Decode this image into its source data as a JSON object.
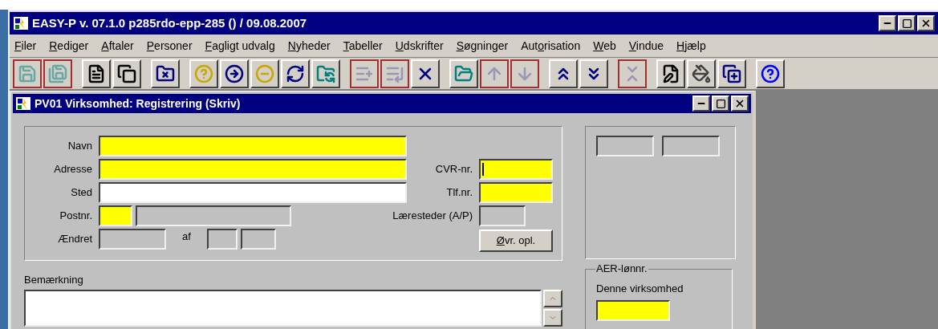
{
  "window": {
    "title": "EASY-P v. 07.1.0 p285rdo-epp-285 () / 09.08.2007"
  },
  "menu": [
    {
      "key": "F",
      "post": "iler"
    },
    {
      "key": "R",
      "post": "ediger"
    },
    {
      "key": "A",
      "post": "ftaler"
    },
    {
      "key": "P",
      "post": "ersoner"
    },
    {
      "key": "F",
      "post": "agligt udvalg"
    },
    {
      "key": "N",
      "post": "yheder"
    },
    {
      "key": "T",
      "post": "abeller"
    },
    {
      "key": "U",
      "post": "dskrifter"
    },
    {
      "key": "S",
      "post": "øgninger"
    },
    {
      "pre": "Aut",
      "key": "o",
      "post": "risation"
    },
    {
      "key": "W",
      "post": "eb"
    },
    {
      "key": "V",
      "post": "indue"
    },
    {
      "key": "H",
      "post": "jælp"
    }
  ],
  "toolbar": [
    [
      {
        "kind": "save",
        "disabled": true
      },
      {
        "kind": "save-next",
        "disabled": true
      }
    ],
    [
      {
        "kind": "document",
        "disabled": false
      },
      {
        "kind": "copy",
        "disabled": false
      }
    ],
    [
      {
        "kind": "folder-x",
        "disabled": false
      }
    ],
    [
      {
        "kind": "query",
        "disabled": false
      },
      {
        "kind": "query-run",
        "disabled": false
      },
      {
        "kind": "query-cancel",
        "disabled": false
      },
      {
        "kind": "refresh",
        "disabled": false
      },
      {
        "kind": "folder-sync",
        "disabled": false
      }
    ],
    [
      {
        "kind": "insert",
        "disabled": true
      },
      {
        "kind": "duplicate",
        "disabled": true
      },
      {
        "kind": "delete",
        "disabled": false
      }
    ],
    [
      {
        "kind": "folder-open",
        "disabled": false
      },
      {
        "kind": "up",
        "disabled": true
      },
      {
        "kind": "down",
        "disabled": true
      }
    ],
    [
      {
        "kind": "first",
        "disabled": false
      },
      {
        "kind": "last",
        "disabled": false
      }
    ],
    [
      {
        "kind": "collapse",
        "disabled": true
      }
    ],
    [
      {
        "kind": "edit",
        "disabled": false
      },
      {
        "kind": "bucket",
        "disabled": false
      },
      {
        "kind": "copy-add",
        "disabled": false
      }
    ],
    [
      {
        "kind": "help",
        "disabled": false
      }
    ]
  ],
  "form_window": {
    "title": "PV01 Virksomhed: Registrering (Skriv)"
  },
  "left_rows": [
    {
      "label": "Navn",
      "inputs": [
        {
          "kind": "required"
        }
      ]
    },
    {
      "label": "Adresse",
      "inputs": [
        {
          "kind": "required"
        }
      ]
    },
    {
      "label": "Sted",
      "inputs": [
        {
          "kind": "normal"
        }
      ]
    },
    {
      "label": "Postnr.",
      "inputs": [
        {
          "kind": "required"
        },
        {
          "kind": "readonly"
        }
      ]
    },
    {
      "label": "Ændret",
      "inputs": [
        {
          "kind": "readonly"
        },
        {
          "kind": "text",
          "text": "af"
        },
        {
          "kind": "readonly"
        },
        {
          "kind": "readonly"
        }
      ]
    }
  ],
  "right_rows": [
    {
      "label": "CVR-nr.",
      "kind": "required",
      "focused": true
    },
    {
      "label": "Tlf.nr.",
      "kind": "required",
      "focused": false
    },
    {
      "label": "Læresteder (A/P)",
      "kind": "readonly",
      "focused": false
    }
  ],
  "more_button": {
    "key": "Ø",
    "post": "vr. opl."
  },
  "summary_fields": [
    {
      "kind": "readonly"
    },
    {
      "kind": "readonly"
    }
  ],
  "remarks": {
    "label": "Bemærkning",
    "kind": "normal"
  },
  "aer": {
    "title": "AER-lønnr.",
    "label": "Denne virksomhed",
    "kind": "required"
  }
}
